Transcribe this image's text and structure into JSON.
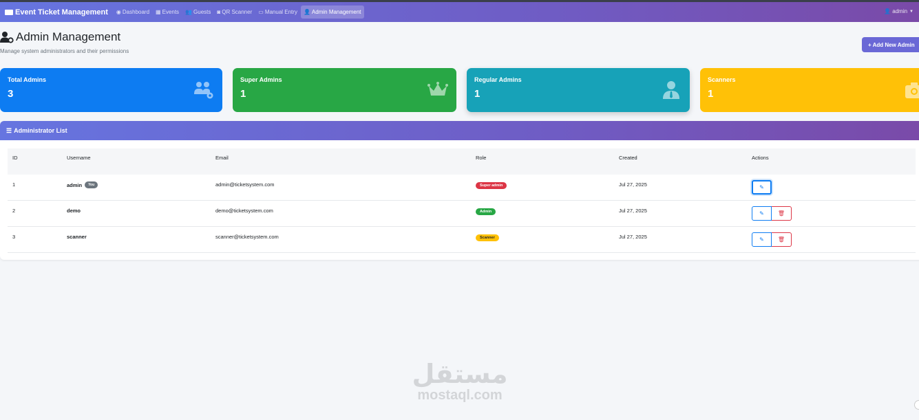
{
  "navbar": {
    "brand": "Event Ticket Management",
    "items": [
      {
        "label": "Dashboard",
        "icon": "◉"
      },
      {
        "label": "Events",
        "icon": "▦"
      },
      {
        "label": "Guests",
        "icon": "👥"
      },
      {
        "label": "QR Scanner",
        "icon": "◙"
      },
      {
        "label": "Manual Entry",
        "icon": "▭"
      },
      {
        "label": "Admin Management",
        "icon": "👤"
      }
    ],
    "active_index": 5,
    "user": "admin"
  },
  "page": {
    "title": "Admin Management",
    "subtitle": "Manage system administrators and their permissions",
    "add_button": "+ Add New Admin"
  },
  "stats": [
    {
      "label": "Total Admins",
      "value": "3",
      "icon": "users-cog-icon",
      "color": "#0d7cf2"
    },
    {
      "label": "Super Admins",
      "value": "1",
      "icon": "crown-icon",
      "color": "#28a745"
    },
    {
      "label": "Regular Admins",
      "value": "1",
      "icon": "user-tie-icon",
      "color": "#17a2b8"
    },
    {
      "label": "Scanners",
      "value": "1",
      "icon": "camera-icon",
      "color": "#ffc107"
    }
  ],
  "list": {
    "title": "Administrator List",
    "columns": [
      "ID",
      "Username",
      "Email",
      "Role",
      "Created",
      "Actions"
    ],
    "rows": [
      {
        "id": "1",
        "username": "admin",
        "you": "You",
        "email": "admin@ticketsystem.com",
        "role": "Super admin",
        "created": "Jul 27, 2025"
      },
      {
        "id": "2",
        "username": "demo",
        "you": "",
        "email": "demo@ticketsystem.com",
        "role": "Admin",
        "created": "Jul 27, 2025"
      },
      {
        "id": "3",
        "username": "scanner",
        "you": "",
        "email": "scanner@ticketsystem.com",
        "role": "Scanner",
        "created": "Jul 27, 2025"
      }
    ]
  },
  "watermark": {
    "arabic": "مستقل",
    "latin": "mostaql.com"
  }
}
